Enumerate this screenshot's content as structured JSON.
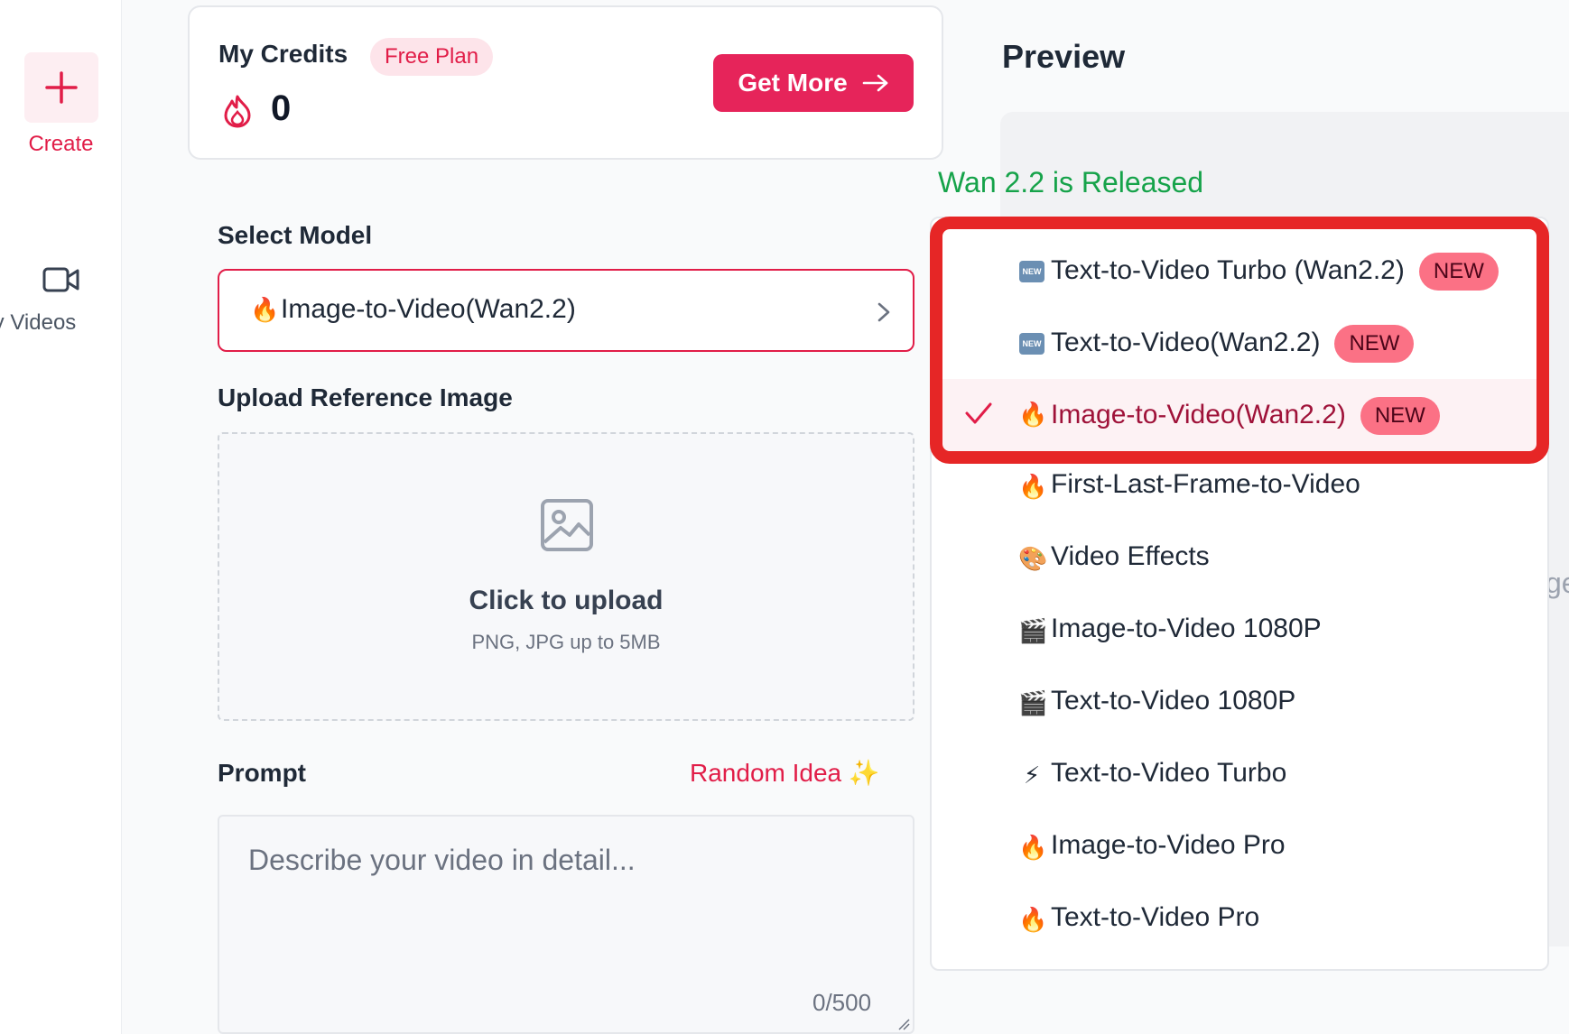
{
  "sidebar": {
    "create_label": "Create",
    "videos_label": "My Videos"
  },
  "credits": {
    "title": "My Credits",
    "plan": "Free Plan",
    "value": "0",
    "cta": "Get More"
  },
  "form": {
    "select_model_label": "Select Model",
    "selected_model": "Image-to-Video(Wan2.2)",
    "selected_model_emoji": "🔥",
    "upload_label": "Upload Reference Image",
    "upload_title": "Click to upload",
    "upload_sub": "PNG, JPG up to 5MB",
    "prompt_label": "Prompt",
    "random_idea": "Random Idea ✨",
    "prompt_placeholder": "Describe your video in detail...",
    "prompt_counter": "0/500"
  },
  "preview": {
    "title": "Preview",
    "peek_text": "ge"
  },
  "announcement": "Wan 2.2 is Released",
  "dropdown": {
    "new_badge": "NEW",
    "items": [
      {
        "emoji": "NEW",
        "label": "Text-to-Video Turbo (Wan2.2)",
        "is_new": true
      },
      {
        "emoji": "NEW",
        "label": "Text-to-Video(Wan2.2)",
        "is_new": true
      },
      {
        "emoji": "🔥",
        "label": "Image-to-Video(Wan2.2)",
        "is_new": true,
        "selected": true
      },
      {
        "emoji": "🔥",
        "label": "First-Last-Frame-to-Video"
      },
      {
        "emoji": "🎨",
        "label": "Video Effects"
      },
      {
        "emoji": "🎬",
        "label": "Image-to-Video 1080P"
      },
      {
        "emoji": "🎬",
        "label": "Text-to-Video 1080P"
      },
      {
        "emoji": "⚡",
        "label": "Text-to-Video Turbo"
      },
      {
        "emoji": "🔥",
        "label": "Image-to-Video Pro"
      },
      {
        "emoji": "🔥",
        "label": "Text-to-Video Pro"
      }
    ]
  },
  "colors": {
    "accent": "#e6245a",
    "highlight": "#e62626",
    "announce": "#16a34a"
  }
}
